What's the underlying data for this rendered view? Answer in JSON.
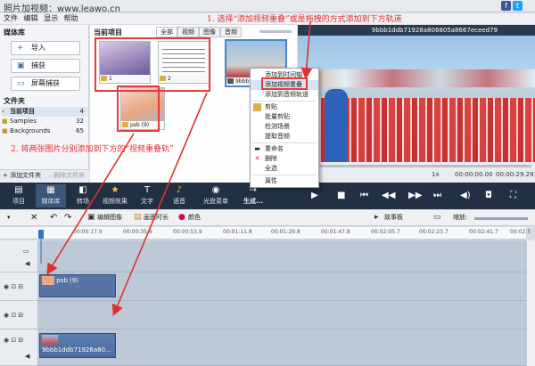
{
  "window": {
    "title": "照片加视频：www.leawo.cn",
    "social_f": "f",
    "social_t": "t",
    "minimize": "–",
    "maximize": "□",
    "close": "✕"
  },
  "menu": [
    "文件",
    "编辑",
    "显示",
    "帮助"
  ],
  "sidebar": {
    "heading": "媒体库",
    "buttons": [
      {
        "label": "导入",
        "icon": "import-icon"
      },
      {
        "label": "捕获",
        "icon": "capture-icon"
      },
      {
        "label": "屏幕捕获",
        "icon": "screen-capture-icon"
      }
    ],
    "folder_heading": "文件夹",
    "folders": [
      {
        "label": "当前项目",
        "count": "4"
      },
      {
        "label": "Samples",
        "count": "32"
      },
      {
        "label": "Backgrounds",
        "count": "65"
      }
    ],
    "add_folder": "+ 添加文件夹",
    "delete_folder": "– 删除文件夹"
  },
  "media": {
    "heading": "当前项目",
    "tabs": [
      "全部",
      "视频",
      "图像",
      "音频"
    ],
    "thumbs": [
      {
        "label": "1"
      },
      {
        "label": "2"
      },
      {
        "label": "9bbb1ddb7..."
      },
      {
        "label": "psb (9)"
      }
    ]
  },
  "preview": {
    "filename": "9bbb1ddb71928a806805a8667eceed79",
    "speed": "1x",
    "time_current": "00:00:00.00",
    "time_total": "00:00:29.291"
  },
  "context_menu": [
    "添加到时间轴",
    "添加视频重叠",
    "添加到音频轨道",
    "剪贴",
    "批量剪贴",
    "检测场景",
    "提取音频",
    "重命名",
    "删除",
    "全选",
    "属性"
  ],
  "toolbar": {
    "tools": [
      "项目",
      "媒体库",
      "转场",
      "视频效果",
      "文字",
      "语音",
      "光盘菜单",
      "生成..."
    ]
  },
  "timeline_toolbar": {
    "edit_image": "编辑图像",
    "duration": "画面时长",
    "color": "颜色",
    "storyboard": "故事板",
    "zoom": "缩放:"
  },
  "ruler_ticks": [
    "00:00:17.9",
    "00:00:35.9",
    "00:00:53.9",
    "00:01:11.8",
    "00:01:29.8",
    "00:01:47.8",
    "00:02:05.7",
    "00:02:23.7",
    "00:02:41.7",
    "00:02:5"
  ],
  "clips": [
    {
      "label": "psb (9)",
      "track": "overlay"
    },
    {
      "label": "9bbb1ddb71928a80...",
      "track": "video"
    }
  ],
  "annotations": {
    "top": "1. 选择“添加视频重叠”或是拖拽的方式添加到下方轨道",
    "left": "2. 将两张图片分别添加到下方的“视频重叠轨”"
  },
  "colors": {
    "accent": "#3b5778",
    "annotation": "#e03030",
    "toolbar_bg": "#213042"
  }
}
